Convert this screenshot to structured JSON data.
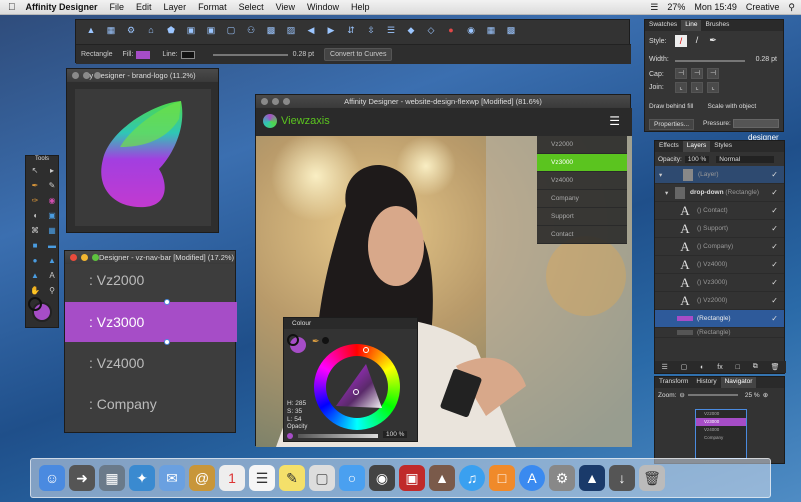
{
  "menubar": {
    "apple": "",
    "app": "Affinity Designer",
    "items": [
      "File",
      "Edit",
      "Layer",
      "Format",
      "Select",
      "View",
      "Window",
      "Help"
    ],
    "battery": "27%",
    "clock": "Mon 15:49",
    "user": "Creative"
  },
  "context_toolbar": {
    "shape_label": "Rectangle",
    "fill_label": "Fill:",
    "line_label": "Line:",
    "line_value": "0.28 pt",
    "convert_label": "Convert to Curves"
  },
  "stroke_panel": {
    "tabs": [
      "Swatches",
      "Line",
      "Brushes"
    ],
    "style_label": "Style:",
    "width_label": "Width:",
    "width_value": "0.28 pt",
    "cap_label": "Cap:",
    "join_label": "Join:",
    "draw_behind": "Draw behind fill",
    "scale_with": "Scale with object",
    "properties": "Properties...",
    "pressure": "Pressure:"
  },
  "brand_window": {
    "title": "y Designer - brand-logo (11.2%)"
  },
  "tools_panel": {
    "title": "Tools"
  },
  "main_window": {
    "title": "Affinity Designer - website-design-flexwp [Modified] (81.6%)",
    "logo_text": "Viewzaxis",
    "menu_items": [
      "Vz2000",
      "Vz3000",
      "Vz4000",
      "Company",
      "Support",
      "Contact"
    ],
    "active_index": 1
  },
  "navbar_window": {
    "title": "Designer - vz-nav-bar [Modified] (17.2%)",
    "items": [
      ": Vz2000",
      ": Vz3000",
      ": Vz4000",
      ": Company"
    ]
  },
  "colour_panel": {
    "title": "Colour",
    "h": "H: 285",
    "s": "S: 35",
    "l": "L: 54",
    "opacity_label": "Opacity",
    "opacity_value": "100 %"
  },
  "layers_panel": {
    "tabs": [
      "Effects",
      "Layers",
      "Styles"
    ],
    "opacity_label": "Opacity:",
    "opacity_value": "100 %",
    "blend": "Normal",
    "rows": [
      {
        "name": "(Layer)",
        "glyph": "",
        "sub": ""
      },
      {
        "name": "drop-down",
        "glyph": "",
        "sub": "(Rectangle)"
      },
      {
        "name": "() Contact)",
        "glyph": "A",
        "sub": ""
      },
      {
        "name": "() Support)",
        "glyph": "A",
        "sub": ""
      },
      {
        "name": "() Company)",
        "glyph": "A",
        "sub": ""
      },
      {
        "name": "() Vz4000)",
        "glyph": "A",
        "sub": ""
      },
      {
        "name": "() Vz3000)",
        "glyph": "A",
        "sub": ""
      },
      {
        "name": "() Vz2000)",
        "glyph": "A",
        "sub": ""
      },
      {
        "name": "(Rectangle)",
        "glyph": "",
        "sub": ""
      },
      {
        "name": "(Rectangle)",
        "glyph": "",
        "sub": ""
      }
    ]
  },
  "navigator_panel": {
    "tabs": [
      "Transform",
      "History",
      "Navigator"
    ],
    "zoom_label": "Zoom:",
    "zoom_value": "25 %",
    "preview_items": [
      "Vz2000",
      "Vz3000",
      "Vz4000",
      "Company"
    ]
  },
  "desktop_label": "designer",
  "colors": {
    "accent_green": "#5bc41f",
    "purple": "#a64dc7",
    "panel_bg": "#3a3a3a"
  }
}
